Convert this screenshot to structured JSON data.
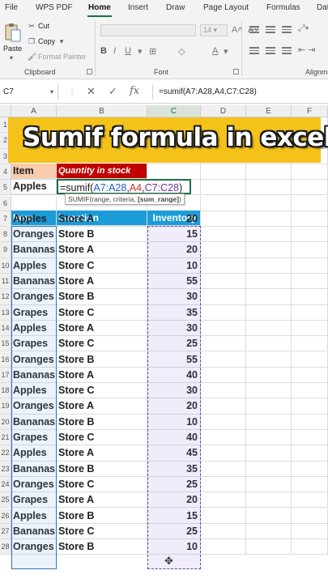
{
  "ribbon": {
    "tabs": [
      "File",
      "WPS PDF",
      "Home",
      "Insert",
      "Draw",
      "Page Layout",
      "Formulas",
      "Dat"
    ],
    "active_tab": "Home",
    "clipboard": {
      "paste": "Paste",
      "cut": "Cut",
      "copy": "Copy",
      "format_painter": "Format Painter",
      "group_label": "Clipboard"
    },
    "font": {
      "size": "14",
      "group_label": "Font"
    },
    "alignment": {
      "group_label": "Alignm"
    }
  },
  "formula_bar": {
    "name_box": "C7",
    "formula": "=sumif(A7:A28,A4,C7:C28)"
  },
  "columns": [
    "A",
    "B",
    "C",
    "D",
    "E",
    "F"
  ],
  "rows": [
    "1",
    "2",
    "3",
    "4",
    "5",
    "6",
    "7",
    "8",
    "9",
    "10",
    "11",
    "12",
    "13",
    "14",
    "15",
    "16",
    "17",
    "18",
    "19",
    "20",
    "21",
    "22",
    "23",
    "24",
    "25",
    "26",
    "27",
    "28"
  ],
  "banner": {
    "text": "Sumif formula in excel"
  },
  "criteria": {
    "item_header": "Item",
    "qty_header": "Quantity in stock",
    "item_value": "Apples",
    "formula_parts": [
      "=sumif(",
      "A7:A28",
      ",",
      "A4",
      ",",
      "C7:C28",
      ")"
    ],
    "tooltip": {
      "fn": "SUMIF(range, criteria, ",
      "opt": "[sum_range]",
      "close": ")"
    }
  },
  "table": {
    "headers": [
      "Item",
      "Location",
      "Inventory"
    ],
    "rows": [
      [
        "Apples",
        "Store A",
        "20"
      ],
      [
        "Oranges",
        "Store B",
        "15"
      ],
      [
        "Bananas",
        "Store A",
        "20"
      ],
      [
        "Apples",
        "Store C",
        "10"
      ],
      [
        "Bananas",
        "Store A",
        "55"
      ],
      [
        "Oranges",
        "Store B",
        "30"
      ],
      [
        "Grapes",
        "Store C",
        "35"
      ],
      [
        "Apples",
        "Store A",
        "30"
      ],
      [
        "Grapes",
        "Store C",
        "25"
      ],
      [
        "Oranges",
        "Store B",
        "55"
      ],
      [
        "Bananas",
        "Store A",
        "40"
      ],
      [
        "Apples",
        "Store C",
        "30"
      ],
      [
        "Oranges",
        "Store A",
        "20"
      ],
      [
        "Bananas",
        "Store B",
        "10"
      ],
      [
        "Grapes",
        "Store C",
        "40"
      ],
      [
        "Apples",
        "Store A",
        "45"
      ],
      [
        "Bananas",
        "Store B",
        "35"
      ],
      [
        "Oranges",
        "Store C",
        "25"
      ],
      [
        "Grapes",
        "Store A",
        "20"
      ],
      [
        "Apples",
        "Store B",
        "15"
      ],
      [
        "Bananas",
        "Store C",
        "25"
      ],
      [
        "Oranges",
        "Store B",
        "10"
      ]
    ]
  },
  "colors": {
    "item_header": "#f8cbad",
    "qty_header": "#c00000",
    "table_header": "#1b9bd7",
    "banner": "#f4c21a",
    "accent": "#1d6f42"
  }
}
